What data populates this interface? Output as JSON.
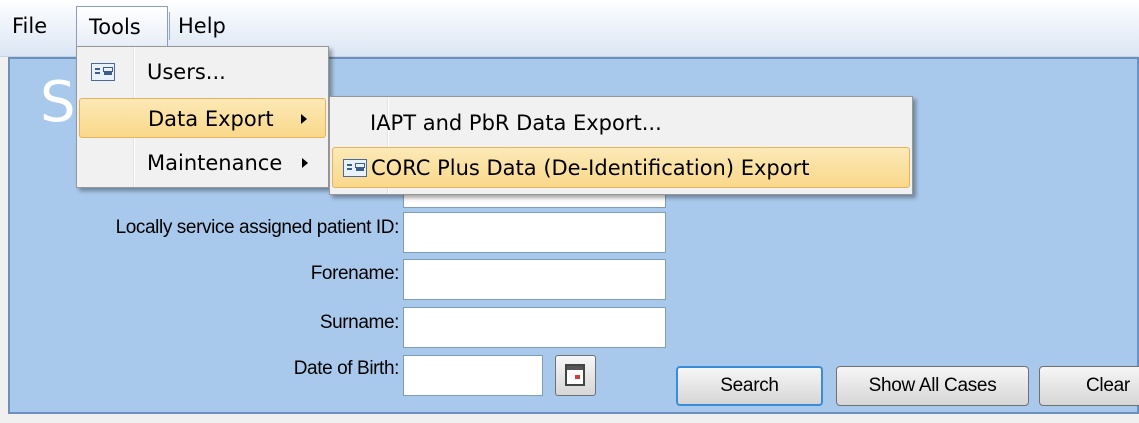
{
  "menubar": {
    "file": "File",
    "tools": "Tools",
    "help": "Help"
  },
  "panel": {
    "title_fragment": "S"
  },
  "form": {
    "locally_assigned_id_label": "Locally service assigned patient ID:",
    "forename_label": "Forename:",
    "surname_label": "Surname:",
    "dob_label": "Date of Birth:",
    "locally_assigned_id_value": "",
    "forename_value": "",
    "surname_value": "",
    "dob_value": ""
  },
  "buttons": {
    "search": "Search",
    "show_all": "Show All Cases",
    "clear": "Clear"
  },
  "tools_menu": {
    "items": [
      {
        "label": "Users...",
        "icon": "form-icon",
        "submenu": false
      },
      {
        "label": "Data Export",
        "submenu": true,
        "highlighted": true
      },
      {
        "label": "Maintenance",
        "submenu": true
      }
    ]
  },
  "export_menu": {
    "items": [
      {
        "label": "IAPT and PbR Data Export..."
      },
      {
        "label": "CORC Plus Data (De-Identification) Export",
        "icon": "form-icon",
        "highlighted": true
      }
    ]
  },
  "colors": {
    "panel_bg": "#a9c9ec",
    "highlight": "#f9d88a",
    "focus_border": "#3a8cd8"
  }
}
